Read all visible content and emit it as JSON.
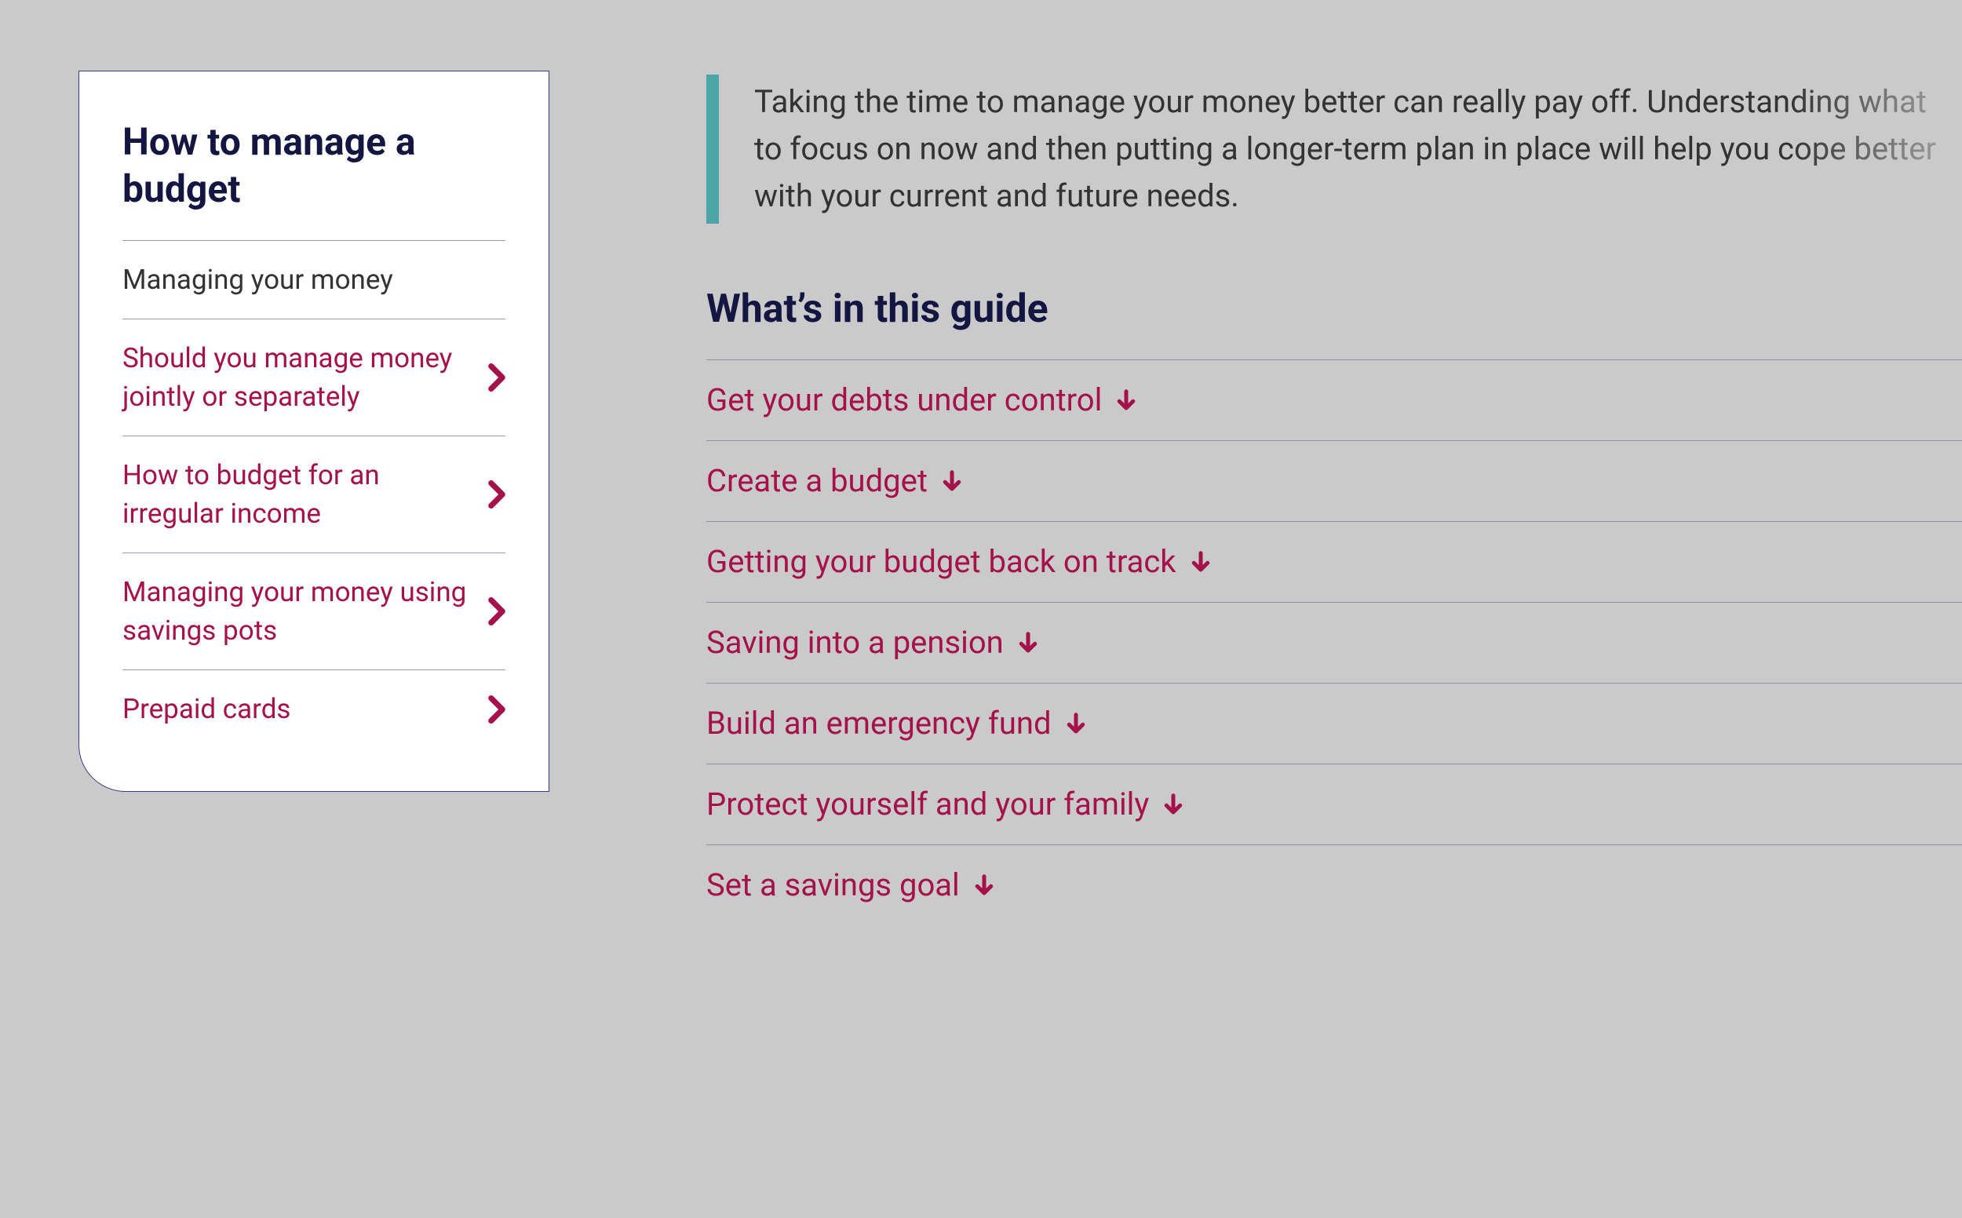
{
  "sidebar": {
    "title": "How to manage a budget",
    "items": [
      {
        "label": "Managing your money",
        "hasChevron": false,
        "current": true
      },
      {
        "label": "Should you manage money jointly or separately",
        "hasChevron": true,
        "current": false
      },
      {
        "label": "How to budget for an irregular income",
        "hasChevron": true,
        "current": false
      },
      {
        "label": "Managing your money using savings pots",
        "hasChevron": true,
        "current": false
      },
      {
        "label": "Prepaid cards",
        "hasChevron": true,
        "current": false
      }
    ]
  },
  "intro": "Taking the time to manage your money better can really pay off. Understanding what to focus on now and then putting a longer-term plan in place will help you cope better with your current and future needs.",
  "guide": {
    "heading": "What’s in this guide",
    "items": [
      {
        "label": "Get your debts under control"
      },
      {
        "label": "Create a budget"
      },
      {
        "label": "Getting your budget back on track"
      },
      {
        "label": "Saving into a pension"
      },
      {
        "label": "Build an emergency fund"
      },
      {
        "label": "Protect yourself and your family"
      },
      {
        "label": "Set a savings goal"
      }
    ]
  }
}
